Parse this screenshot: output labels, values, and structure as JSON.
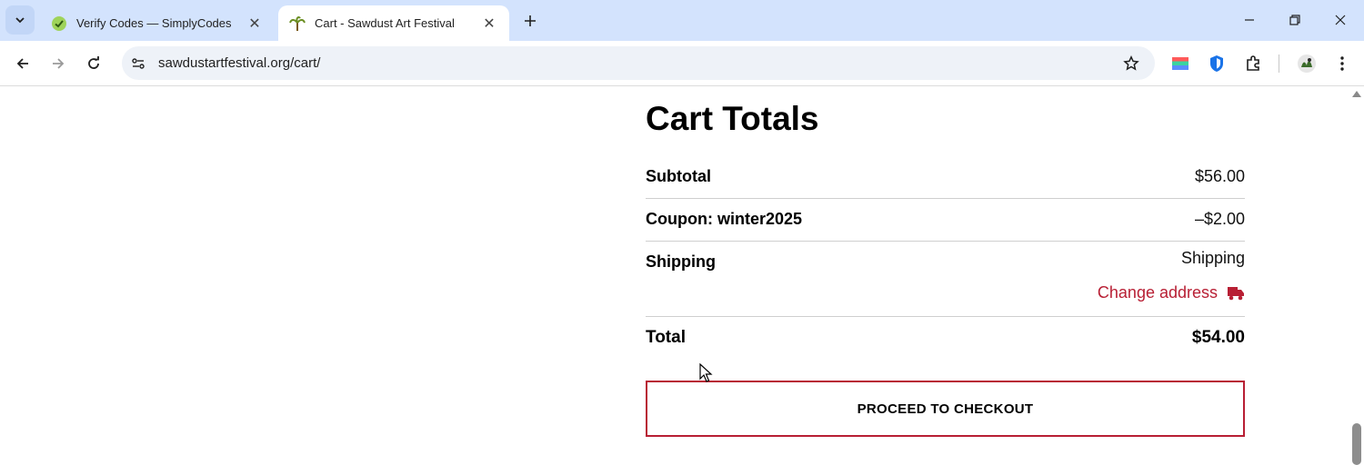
{
  "browser": {
    "tabs": [
      {
        "title": "Verify Codes — SimplyCodes",
        "active": false
      },
      {
        "title": "Cart - Sawdust Art Festival",
        "active": true
      }
    ],
    "url": "sawdustartfestival.org/cart/"
  },
  "cart_totals": {
    "heading": "Cart Totals",
    "subtotal": {
      "label": "Subtotal",
      "value": "$56.00"
    },
    "coupon": {
      "label": "Coupon: winter2025",
      "value": "–$2.00"
    },
    "shipping": {
      "label": "Shipping",
      "value": "Shipping",
      "change_address": "Change address"
    },
    "total": {
      "label": "Total",
      "value": "$54.00"
    },
    "checkout_button": "PROCEED TO CHECKOUT"
  },
  "colors": {
    "accent": "#b81f34",
    "tabstrip": "#d3e3fd"
  }
}
